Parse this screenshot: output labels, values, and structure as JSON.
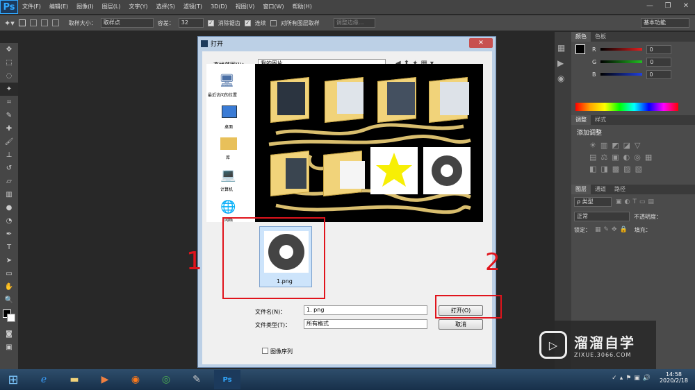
{
  "menubar": {
    "logo": "Ps",
    "items": [
      "文件(F)",
      "编辑(E)",
      "图像(I)",
      "图层(L)",
      "文字(Y)",
      "选择(S)",
      "滤镜(T)",
      "3D(D)",
      "视图(V)",
      "窗口(W)",
      "帮助(H)"
    ]
  },
  "options": {
    "sample_size_label": "取样大小：",
    "sample_size_value": "取样点",
    "tolerance_label": "容差：",
    "tolerance_value": "32",
    "antialias": "消除锯齿",
    "contiguous": "连续",
    "all_layers": "对所有图层取样",
    "refine_edge": "调整边缘...",
    "workspace": "基本功能"
  },
  "panels": {
    "color_tabs": [
      "颜色",
      "色板"
    ],
    "rgb": [
      {
        "ch": "R",
        "val": "0",
        "color": "#e02020"
      },
      {
        "ch": "G",
        "val": "0",
        "color": "#20c020"
      },
      {
        "ch": "B",
        "val": "0",
        "color": "#2040e0"
      }
    ],
    "adjust_tabs": [
      "调整",
      "样式"
    ],
    "adjust_title": "添加调整",
    "layer_tabs": [
      "图层",
      "通道",
      "路径"
    ],
    "layer_kind": "ρ 类型",
    "blend_mode": "正常",
    "opacity_label": "不透明度：",
    "lock_label": "锁定：",
    "fill_label": "填充："
  },
  "dialog": {
    "title": "打开",
    "lookin_label": "查找范围(I)：",
    "lookin_value": "我的图片",
    "places": [
      "最近访问的位置",
      "桌面",
      "库",
      "计算机",
      "网络"
    ],
    "selected_file": "1.png",
    "filename_label": "文件名(N)：",
    "filename_value": "1. png",
    "filetype_label": "文件类型(T)：",
    "filetype_value": "所有格式",
    "open_button": "打开(O)",
    "cancel_button": "取消",
    "image_sequence": "图像序列"
  },
  "annotations": {
    "one": "1",
    "two": "2"
  },
  "watermark": {
    "title": "溜溜自学",
    "url": "ZIXUE.3066.COM"
  },
  "taskbar": {
    "time": "14:58",
    "date": "2020/2/18"
  }
}
